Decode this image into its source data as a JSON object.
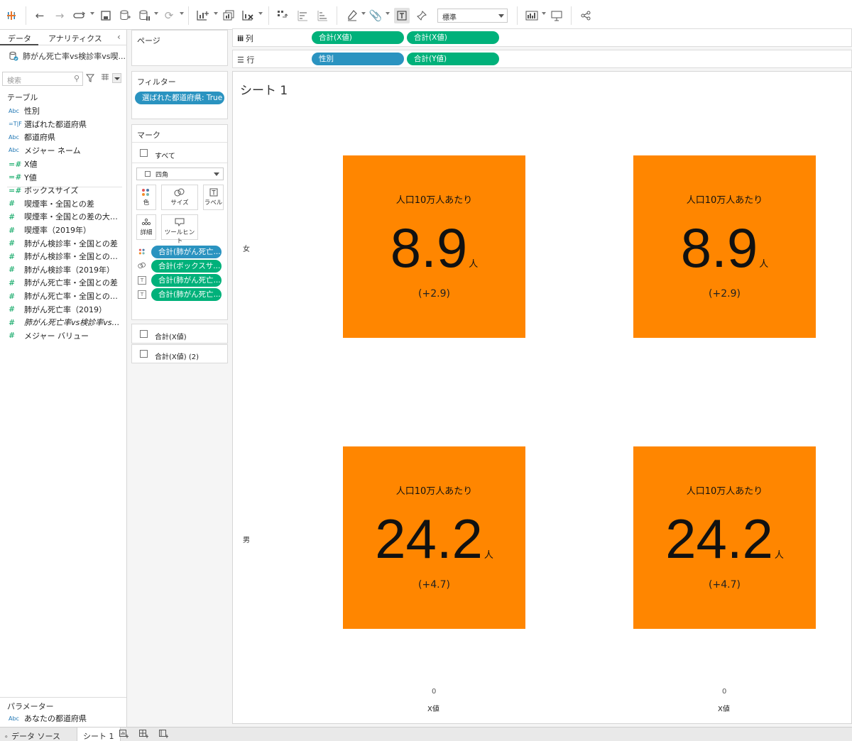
{
  "toolbar": {
    "fit_value": "標準"
  },
  "data_pane": {
    "tab_data": "データ",
    "tab_analytics": "アナリティクス",
    "datasource": "肺がん死亡率vs検診率vs喫...",
    "search_placeholder": "検索",
    "tables_label": "テーブル",
    "dimensions": [
      {
        "type": "Abc",
        "label": "性別"
      },
      {
        "type": "=T|F",
        "label": "選ばれた都道府県"
      },
      {
        "type": "Abc",
        "label": "都道府県"
      },
      {
        "type": "Abc",
        "label": "メジャー ネーム"
      }
    ],
    "measures": [
      {
        "type": "=#",
        "label": "X値"
      },
      {
        "type": "=#",
        "label": "Y値"
      },
      {
        "type": "=#",
        "label": "ボックスサイズ"
      },
      {
        "type": "#",
        "label": "喫煙率・全国との差"
      },
      {
        "type": "#",
        "label": "喫煙率・全国との差の大きさ"
      },
      {
        "type": "#",
        "label": "喫煙率（2019年）"
      },
      {
        "type": "#",
        "label": "肺がん検診率・全国との差"
      },
      {
        "type": "#",
        "label": "肺がん検診率・全国との差の..."
      },
      {
        "type": "#",
        "label": "肺がん検診率（2019年）"
      },
      {
        "type": "#",
        "label": "肺がん死亡率・全国との差"
      },
      {
        "type": "#",
        "label": "肺がん死亡率・全国との差の..."
      },
      {
        "type": "#",
        "label": "肺がん死亡率（2019）"
      },
      {
        "type": "#",
        "label": "肺がん死亡率vs検診率vs喫..."
      },
      {
        "type": "#",
        "label": "メジャー バリュー"
      }
    ],
    "params_label": "パラメーター",
    "params": [
      {
        "type": "Abc",
        "label": "あなたの都道府県"
      }
    ]
  },
  "cards": {
    "pages_title": "ページ",
    "filters_title": "フィルター",
    "filter_pill": "選ばれた都道府県: True",
    "marks_title": "マーク",
    "marks_all": "すべて",
    "mark_type": "四角",
    "buttons": {
      "color": "色",
      "size": "サイズ",
      "label": "ラベル",
      "detail": "詳細",
      "tooltip": "ツールヒント"
    },
    "mark_pills": [
      "合計(肺がん死亡...",
      "合計(ボックスサ...",
      "合計(肺がん死亡...",
      "合計(肺がん死亡..."
    ],
    "sub_marks": [
      "合計(X値)",
      "合計(X値) (2)"
    ]
  },
  "shelves": {
    "columns_label": "列",
    "rows_label": "行",
    "columns": [
      "合計(X値)",
      "合計(X値)"
    ],
    "rows": [
      "性別",
      "合計(Y値)"
    ]
  },
  "sheet": {
    "title": "シート 1",
    "row_labels": [
      "女",
      "男"
    ],
    "tiles": [
      {
        "caption": "人口10万人あたり",
        "value": "8.9",
        "unit": "人",
        "diff": "(+2.9)"
      },
      {
        "caption": "人口10万人あたり",
        "value": "8.9",
        "unit": "人",
        "diff": "(+2.9)"
      },
      {
        "caption": "人口10万人あたり",
        "value": "24.2",
        "unit": "人",
        "diff": "(+4.7)"
      },
      {
        "caption": "人口10万人あたり",
        "value": "24.2",
        "unit": "人",
        "diff": "(+4.7)"
      }
    ],
    "tile_color": "#ff8600",
    "axis_zero": "0",
    "axis_label": "X値"
  },
  "bottom_tabs": {
    "datasource": "データ ソース",
    "sheet": "シート 1"
  }
}
